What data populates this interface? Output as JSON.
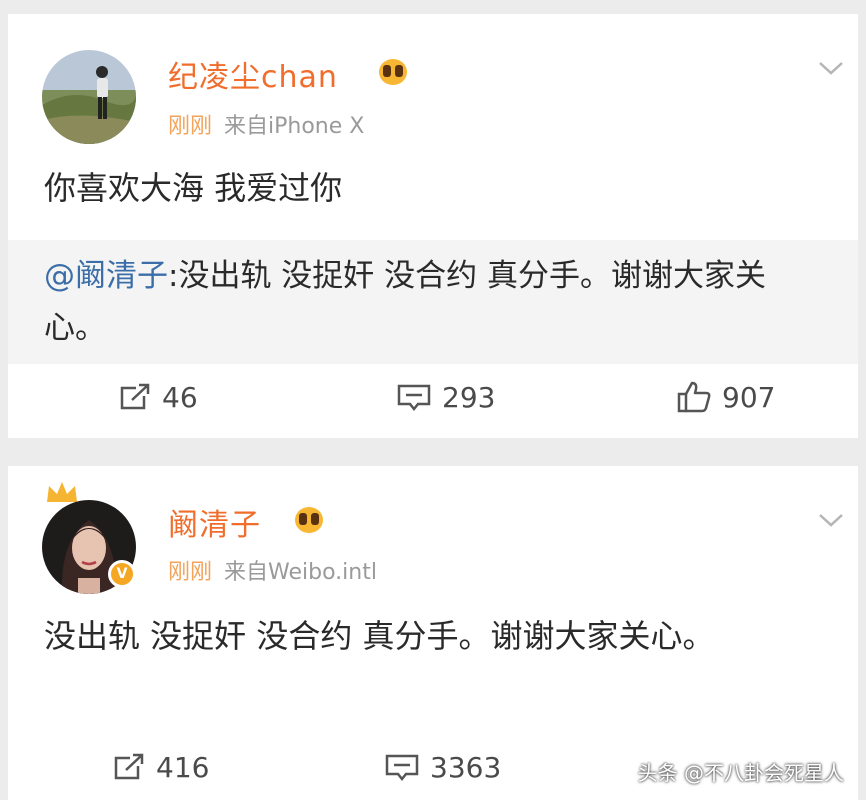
{
  "posts": [
    {
      "username": "纪凌尘chan",
      "time": "刚刚",
      "source": "来自iPhone X",
      "content": "你喜欢大海 我爱过你",
      "repost": {
        "mention": "@阚清子",
        "text": ":没出轨 没捉奸 没合约 真分手。谢谢大家关心。"
      },
      "actions": {
        "repost_count": "46",
        "comment_count": "293",
        "like_count": "907"
      }
    },
    {
      "username": "阚清子",
      "time": "刚刚",
      "source": "来自Weibo.intl",
      "content": "没出轨 没捉奸 没合约 真分手。谢谢大家关心。",
      "verified_badge": "V",
      "actions": {
        "repost_count": "416",
        "comment_count": "3363"
      }
    }
  ],
  "watermark": "头条 @不八卦会死星人",
  "colors": {
    "username": "#f06d2c",
    "time": "#f3a35a",
    "mention": "#3b6ea8",
    "verified": "#f5a623"
  },
  "icons": [
    "repost-icon",
    "comment-icon",
    "like-icon",
    "chevron-down-icon",
    "emoji-icon",
    "crown-icon"
  ]
}
